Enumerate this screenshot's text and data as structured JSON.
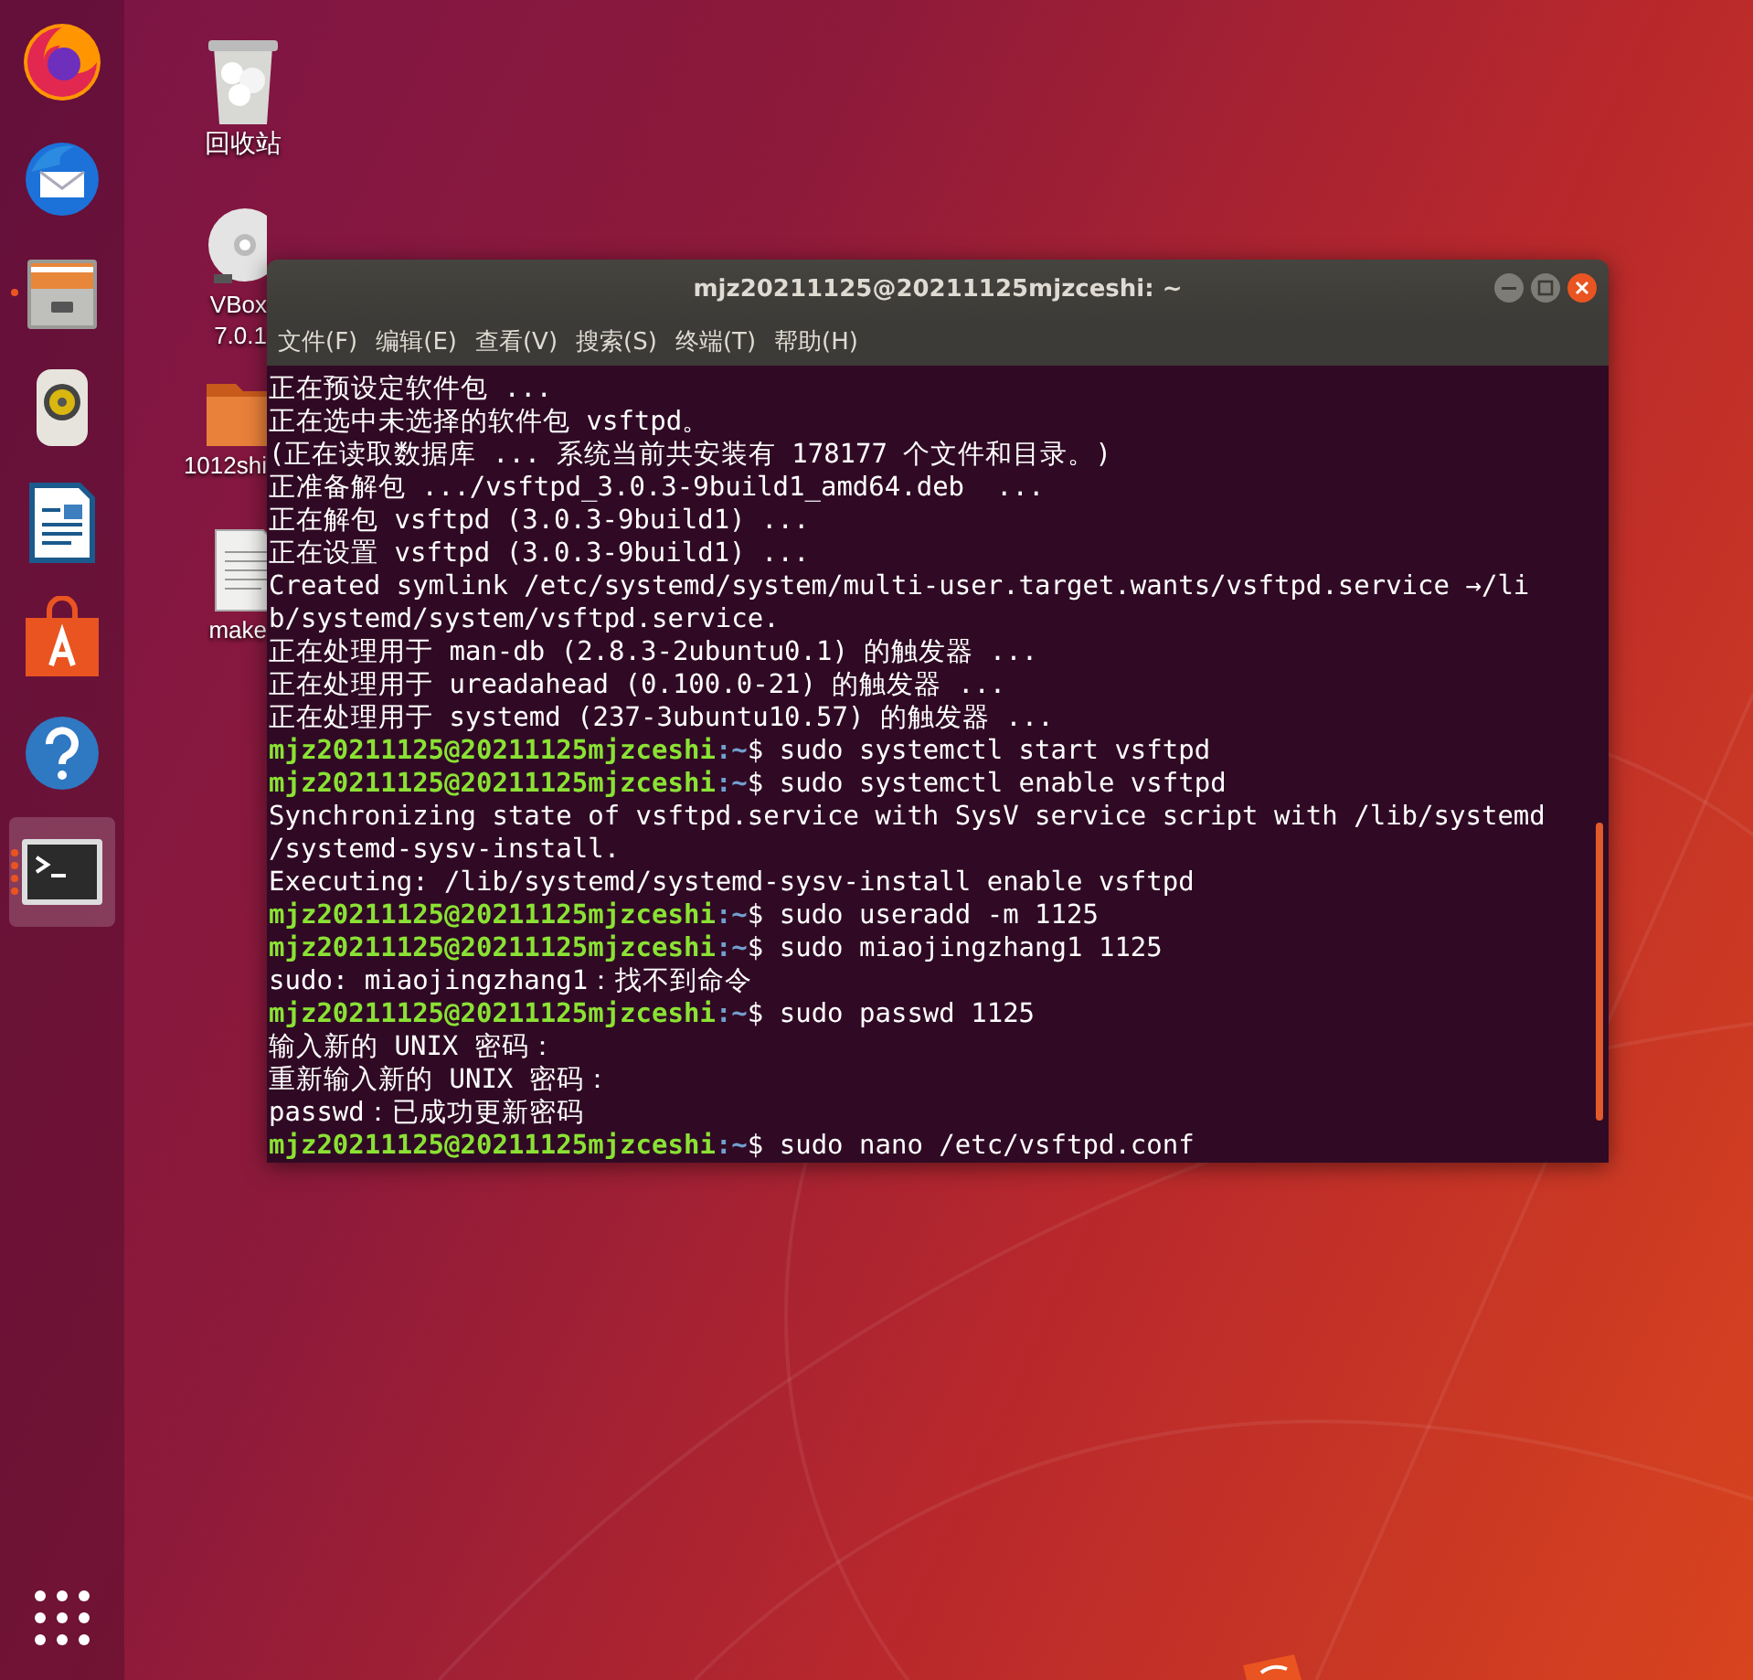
{
  "dock": {
    "items": [
      {
        "kind": "firefox",
        "selected": false
      },
      {
        "kind": "mail",
        "selected": false
      },
      {
        "kind": "files",
        "running": true,
        "selected": false
      },
      {
        "kind": "speaker",
        "selected": false
      },
      {
        "kind": "writer",
        "selected": false
      },
      {
        "kind": "store",
        "selected": false
      },
      {
        "kind": "help",
        "selected": false
      },
      {
        "kind": "terminal",
        "running": true,
        "multiple_windows": true,
        "selected": true
      }
    ]
  },
  "desktop": {
    "icons": [
      {
        "kind": "trash",
        "label": [
          "回收站"
        ]
      },
      {
        "kind": "disc",
        "label": [
          "VBox",
          "7.0.1"
        ]
      },
      {
        "kind": "folder",
        "label": [
          "1012shi"
        ]
      },
      {
        "kind": "document",
        "label": [
          "make"
        ]
      }
    ]
  },
  "terminal": {
    "title": "mjz20211125@20211125mjzceshi: ~",
    "menu": [
      "文件(F)",
      "编辑(E)",
      "查看(V)",
      "搜索(S)",
      "终端(T)",
      "帮助(H)"
    ],
    "lines": [
      {
        "kind": "output",
        "text": "正在预设定软件包 ..."
      },
      {
        "kind": "output",
        "text": "正在选中未选择的软件包 vsftpd。"
      },
      {
        "kind": "output",
        "text": "(正在读取数据库 ... 系统当前共安装有 178177 个文件和目录。)"
      },
      {
        "kind": "output",
        "text": "正准备解包 .../vsftpd_3.0.3-9build1_amd64.deb  ..."
      },
      {
        "kind": "output",
        "text": "正在解包 vsftpd (3.0.3-9build1) ..."
      },
      {
        "kind": "output",
        "text": "正在设置 vsftpd (3.0.3-9build1) ..."
      },
      {
        "kind": "output",
        "text": "Created symlink /etc/systemd/system/multi-user.target.wants/vsftpd.service →/li"
      },
      {
        "kind": "output",
        "text": "b/systemd/system/vsftpd.service."
      },
      {
        "kind": "output",
        "text": "正在处理用于 man-db (2.8.3-2ubuntu0.1) 的触发器 ..."
      },
      {
        "kind": "output",
        "text": "正在处理用于 ureadahead (0.100.0-21) 的触发器 ..."
      },
      {
        "kind": "output",
        "text": "正在处理用于 systemd (237-3ubuntu10.57) 的触发器 ..."
      },
      {
        "kind": "prompt",
        "host": "mjz20211125@20211125mjzceshi",
        "path": ":~",
        "command": "$ sudo systemctl start vsftpd"
      },
      {
        "kind": "prompt",
        "host": "mjz20211125@20211125mjzceshi",
        "path": ":~",
        "command": "$ sudo systemctl enable vsftpd"
      },
      {
        "kind": "output",
        "text": "Synchronizing state of vsftpd.service with SysV service script with /lib/systemd"
      },
      {
        "kind": "output",
        "text": "/systemd-sysv-install."
      },
      {
        "kind": "output",
        "text": "Executing: /lib/systemd/systemd-sysv-install enable vsftpd"
      },
      {
        "kind": "prompt",
        "host": "mjz20211125@20211125mjzceshi",
        "path": ":~",
        "command": "$ sudo useradd -m 1125"
      },
      {
        "kind": "prompt",
        "host": "mjz20211125@20211125mjzceshi",
        "path": ":~",
        "command": "$ sudo miaojingzhang1 1125"
      },
      {
        "kind": "output",
        "text": "sudo: miaojingzhang1：找不到命令"
      },
      {
        "kind": "prompt",
        "host": "mjz20211125@20211125mjzceshi",
        "path": ":~",
        "command": "$ sudo passwd 1125"
      },
      {
        "kind": "output",
        "text": "输入新的 UNIX 密码："
      },
      {
        "kind": "output",
        "text": "重新输入新的 UNIX 密码："
      },
      {
        "kind": "output",
        "text": "passwd：已成功更新密码"
      },
      {
        "kind": "prompt",
        "host": "mjz20211125@20211125mjzceshi",
        "path": ":~",
        "command": "$ sudo nano /etc/vsftpd.conf"
      }
    ]
  }
}
